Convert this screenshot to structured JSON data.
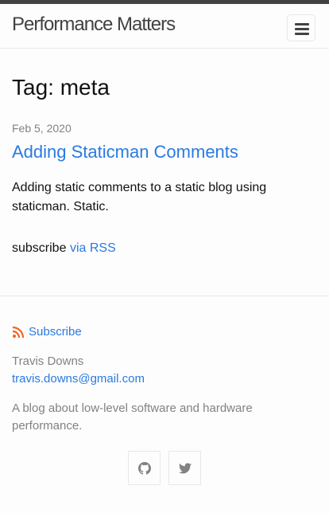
{
  "header": {
    "site_title": "Performance Matters",
    "menu_icon": "hamburger-menu-icon"
  },
  "main": {
    "page_heading": "Tag: meta",
    "posts": [
      {
        "date": "Feb 5, 2020",
        "title": "Adding Staticman Comments",
        "excerpt": "Adding static comments to a static blog using staticman. Static."
      }
    ],
    "subscribe_text": "subscribe",
    "subscribe_link": "via RSS"
  },
  "footer": {
    "rss_label": "Subscribe",
    "rss_icon": "rss-icon",
    "author_name": "Travis Downs",
    "author_email": "travis.downs@gmail.com",
    "description": "A blog about low-level software and hardware performance.",
    "social": [
      {
        "icon": "github-icon"
      },
      {
        "icon": "twitter-icon"
      }
    ]
  },
  "colors": {
    "link": "#2a7ae2",
    "text": "#111111",
    "muted": "#828282",
    "topbar": "#424242"
  }
}
